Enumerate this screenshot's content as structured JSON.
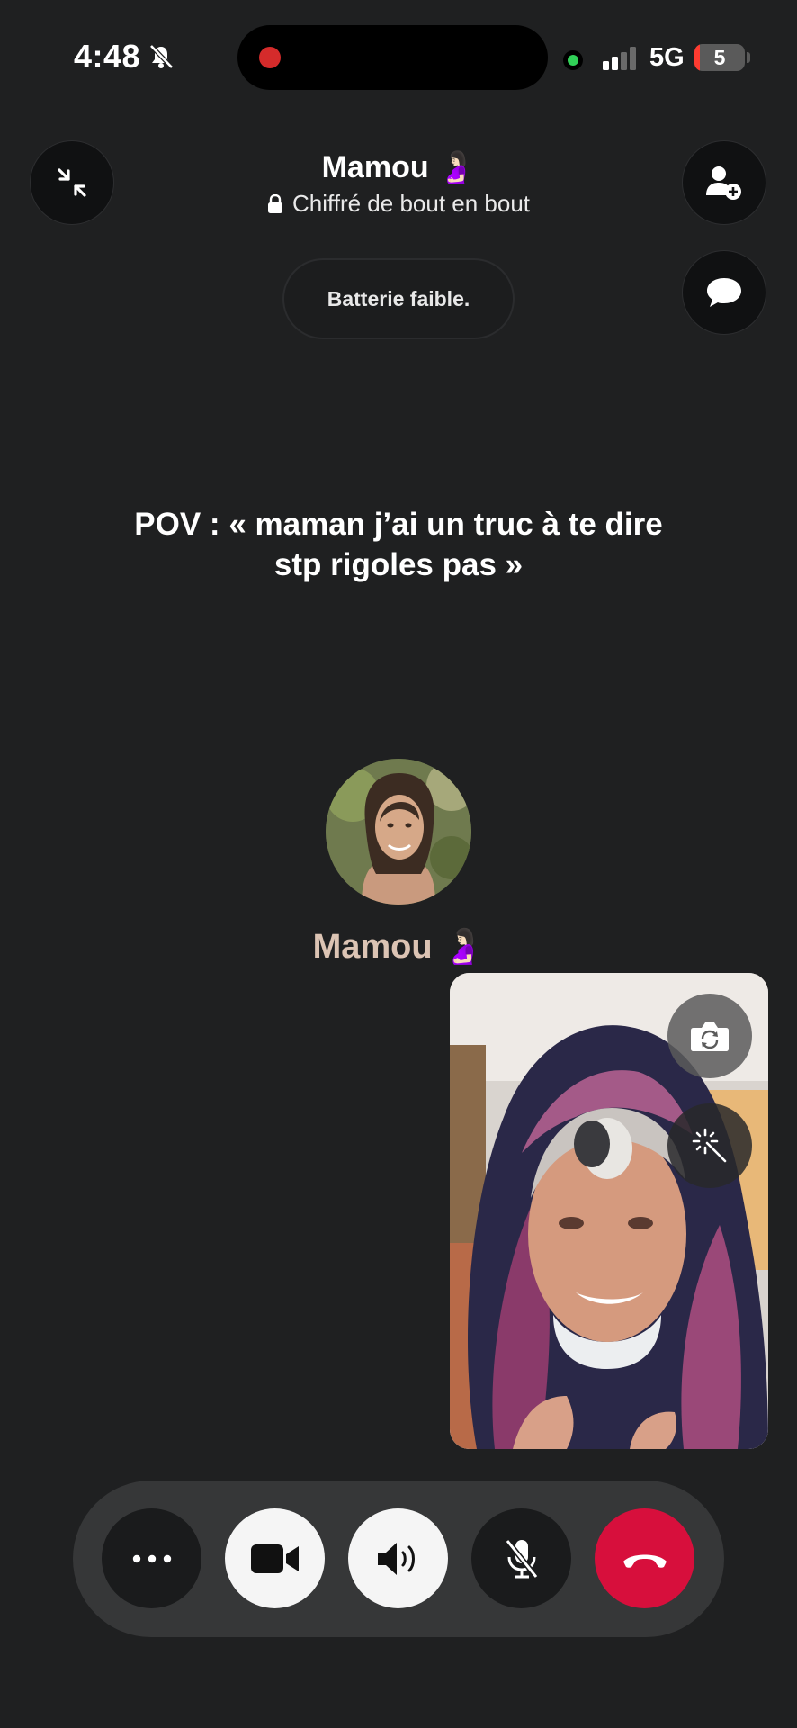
{
  "status_bar": {
    "time": "4:48",
    "network": "5G",
    "battery_level": "5",
    "battery_fraction": 0.05,
    "icons": [
      "bell-slash-icon",
      "recording-dot-icon",
      "privacy-dot-icon",
      "signal-bars-icon",
      "battery-icon"
    ]
  },
  "call": {
    "title": "Mamou 🤰🏻",
    "encryption_label": "Chiffré de bout en bout",
    "battery_notice": "Batterie faible.",
    "callee_name": "Mamou 🤰🏻"
  },
  "caption": {
    "line1": "POV : « maman j’ai un truc à te dire",
    "line2": "stp rigoles pas »"
  },
  "header_buttons": [
    "minimize-icon",
    "add-person-icon",
    "chat-bubble-icon"
  ],
  "self_view_buttons": [
    "camera-flip-icon",
    "effects-wand-icon"
  ],
  "controls": [
    {
      "name": "more",
      "icon": "more-icon"
    },
    {
      "name": "video",
      "icon": "video-camera-icon"
    },
    {
      "name": "speaker",
      "icon": "speaker-icon"
    },
    {
      "name": "mute",
      "icon": "mic-off-icon"
    },
    {
      "name": "end-call",
      "icon": "end-call-icon"
    }
  ],
  "colors": {
    "background": "#1f2021",
    "end_call": "#d70f3c",
    "callee_name": "#dcc4b4",
    "privacy_dot": "#31d158",
    "battery_low": "#ff3b30"
  }
}
